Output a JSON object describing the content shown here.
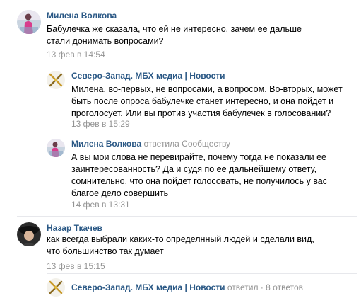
{
  "comments": [
    {
      "author": "Милена Волкова",
      "text": "Бабулечка же сказала, что ей не интересно, зачем ее дальше стали донимать вопросами?",
      "date": "13 фев в 14:54"
    },
    {
      "author": "Северо-Запад. МБХ медиа | Новости",
      "text": "Милена, во-первых, не вопросами, а вопросом. Во-вторых, может быть после опроса бабулечке станет интересно, и она пойдет и проголосует. Или вы против участия бабулечек в голосовании?",
      "date": "13 фев в 15:29"
    },
    {
      "author": "Милена Волкова",
      "replied_to": "ответила Сообществу",
      "text": "А вы мои слова не перевирайте, почему тогда не показали ее заинтересованность? Да и судя по ее дальнейшему ответу, сомнительно, что она пойдет голосовать, не получилось у вас благое дело совершить",
      "date": "14 фев в 13:31"
    },
    {
      "author": "Назар Ткачев",
      "text": "как всегда выбрали каких-то определнный людей и сделали вид, что большинство так думает",
      "date": "13 фев в 15:15"
    },
    {
      "author": "Северо-Запад. МБХ медиа | Новости",
      "replied_to": "ответил",
      "separator": "·",
      "reply_count": "8 ответов"
    }
  ],
  "colors": {
    "link": "#2a5885",
    "muted": "#939393",
    "divider": "#e7e8ec",
    "text": "#000000"
  },
  "icons": {
    "group_avatar": "crossed-swords-logo",
    "user_avatar": "profile-photo"
  }
}
